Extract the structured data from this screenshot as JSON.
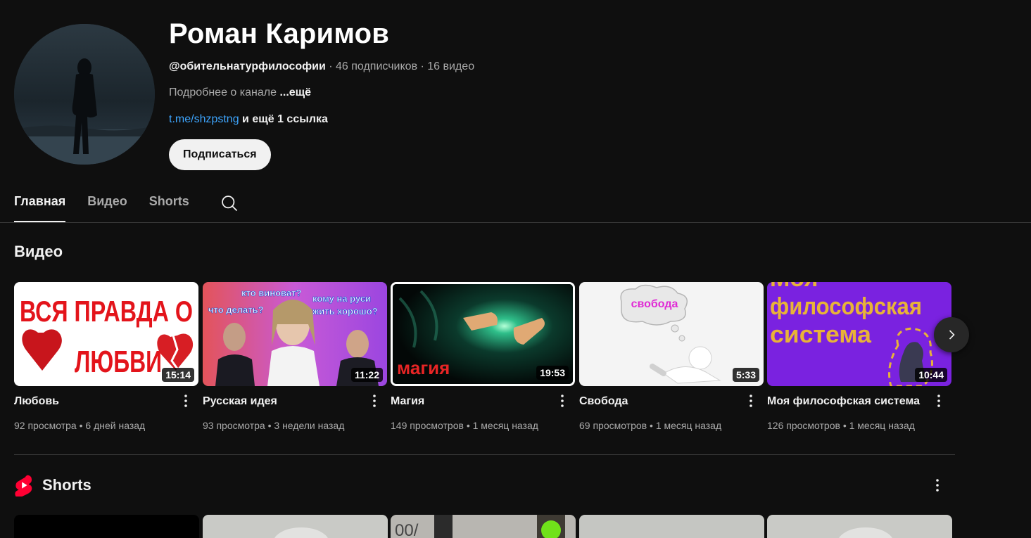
{
  "channel": {
    "name": "Роман Каримов",
    "handle": "@обительнатурфилософии",
    "sep1": " · ",
    "subscribers": "46 подписчиков",
    "sep2": " · ",
    "videos_count": "16 видео",
    "about": "Подробнее о канале ",
    "about_more": "...ещё",
    "link": "t.me/shzpstng",
    "link_more": " и ещё 1 ссылка",
    "subscribe_label": "Подписаться"
  },
  "tabs": [
    {
      "label": "Главная",
      "active": true
    },
    {
      "label": "Видео",
      "active": false
    },
    {
      "label": "Shorts",
      "active": false
    }
  ],
  "sections": {
    "videos_title": "Видео",
    "shorts_title": "Shorts"
  },
  "videos": [
    {
      "title": "Любовь",
      "duration": "15:14",
      "views": "92 просмотра",
      "age": "6 дней назад",
      "thumb_text": [
        "ВСЯ ПРАВДА О",
        "ЛЮБВИ"
      ]
    },
    {
      "title": "Русская идея",
      "duration": "11:22",
      "views": "93 просмотра",
      "age": "3 недели назад",
      "thumb_text": [
        "кто виноват?",
        "что делать?",
        "кому на руси",
        "жить хорошо?"
      ]
    },
    {
      "title": "Магия",
      "duration": "19:53",
      "views": "149 просмотров",
      "age": "1 месяц назад",
      "thumb_text": [
        "магия"
      ]
    },
    {
      "title": "Свобода",
      "duration": "5:33",
      "views": "69 просмотров",
      "age": "1 месяц назад",
      "thumb_text": [
        "свобода"
      ]
    },
    {
      "title": "Моя философская система",
      "duration": "10:44",
      "views": "126 просмотров",
      "age": "1 месяц назад",
      "thumb_text": [
        "Моя",
        "философская",
        "система"
      ]
    }
  ],
  "meta_sep": " • ",
  "shorts_thumb_text": "00/",
  "colors": {
    "background": "#0f0f0f",
    "link": "#3ea6ff",
    "secondary_text": "#aaaaaa",
    "shorts_red": "#ff0033"
  },
  "icons": [
    "search-icon",
    "chevron-right-icon",
    "more-vert-icon",
    "shorts-logo-icon"
  ]
}
